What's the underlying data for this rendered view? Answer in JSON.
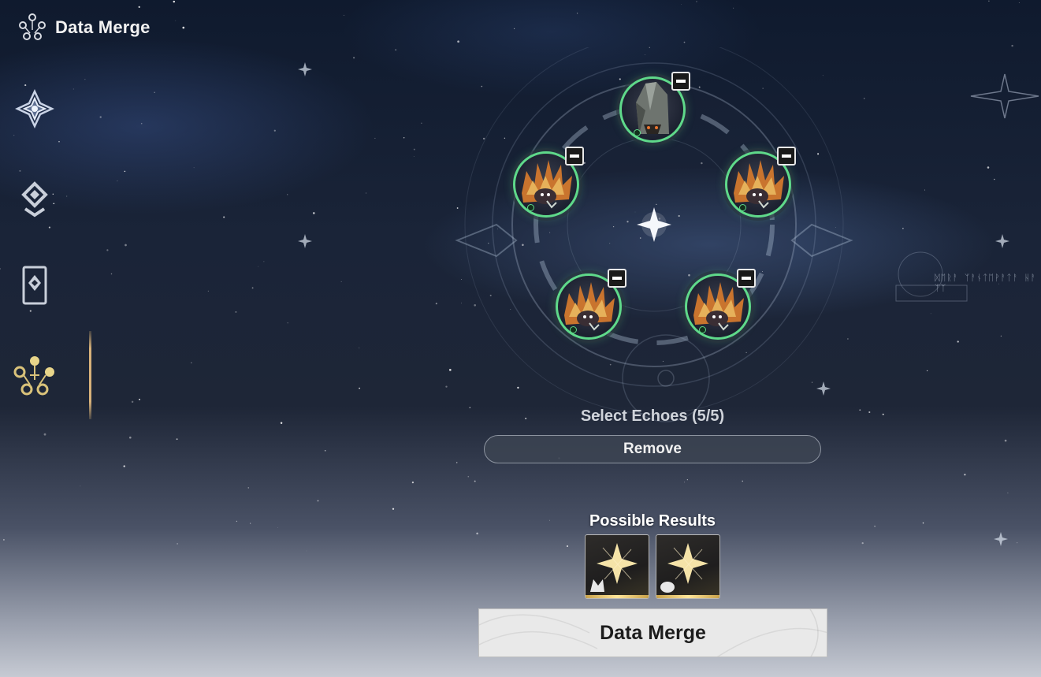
{
  "header": {
    "title": "Data Merge",
    "icon": "data-merge-icon"
  },
  "sidebar": {
    "items": [
      {
        "id": "echo-icon",
        "active": false
      },
      {
        "id": "tune-icon",
        "active": false
      },
      {
        "id": "card-icon",
        "active": false
      },
      {
        "id": "data-merge-icon",
        "active": true
      }
    ],
    "active_color": "#d8b27a"
  },
  "echo_slots": {
    "count_selected": 5,
    "count_max": 5,
    "items": [
      {
        "name": "echo-slot-top",
        "echo": "stone-golem-echo"
      },
      {
        "name": "echo-slot-left",
        "echo": "flame-bird-echo"
      },
      {
        "name": "echo-slot-right",
        "echo": "flame-bird-echo"
      },
      {
        "name": "echo-slot-bottom-left",
        "echo": "flame-bird-echo"
      },
      {
        "name": "echo-slot-bottom-right",
        "echo": "flame-bird-echo"
      }
    ],
    "ring_color": "#5fd98a"
  },
  "selection": {
    "label": "Select Echoes (5/5)",
    "remove_label": "Remove"
  },
  "results": {
    "label": "Possible Results",
    "items": [
      {
        "name": "result-card-1",
        "rarity_color": "#e8c870"
      },
      {
        "name": "result-card-2",
        "rarity_color": "#e8c870"
      }
    ]
  },
  "action": {
    "merge_label": "Data Merge"
  },
  "decor_text": "ᛞᛖᚱᚨ ᛉᚨᚾᛏᛖᚹᚨᛏᚨ ᚺᚨ ᛉᛉ"
}
